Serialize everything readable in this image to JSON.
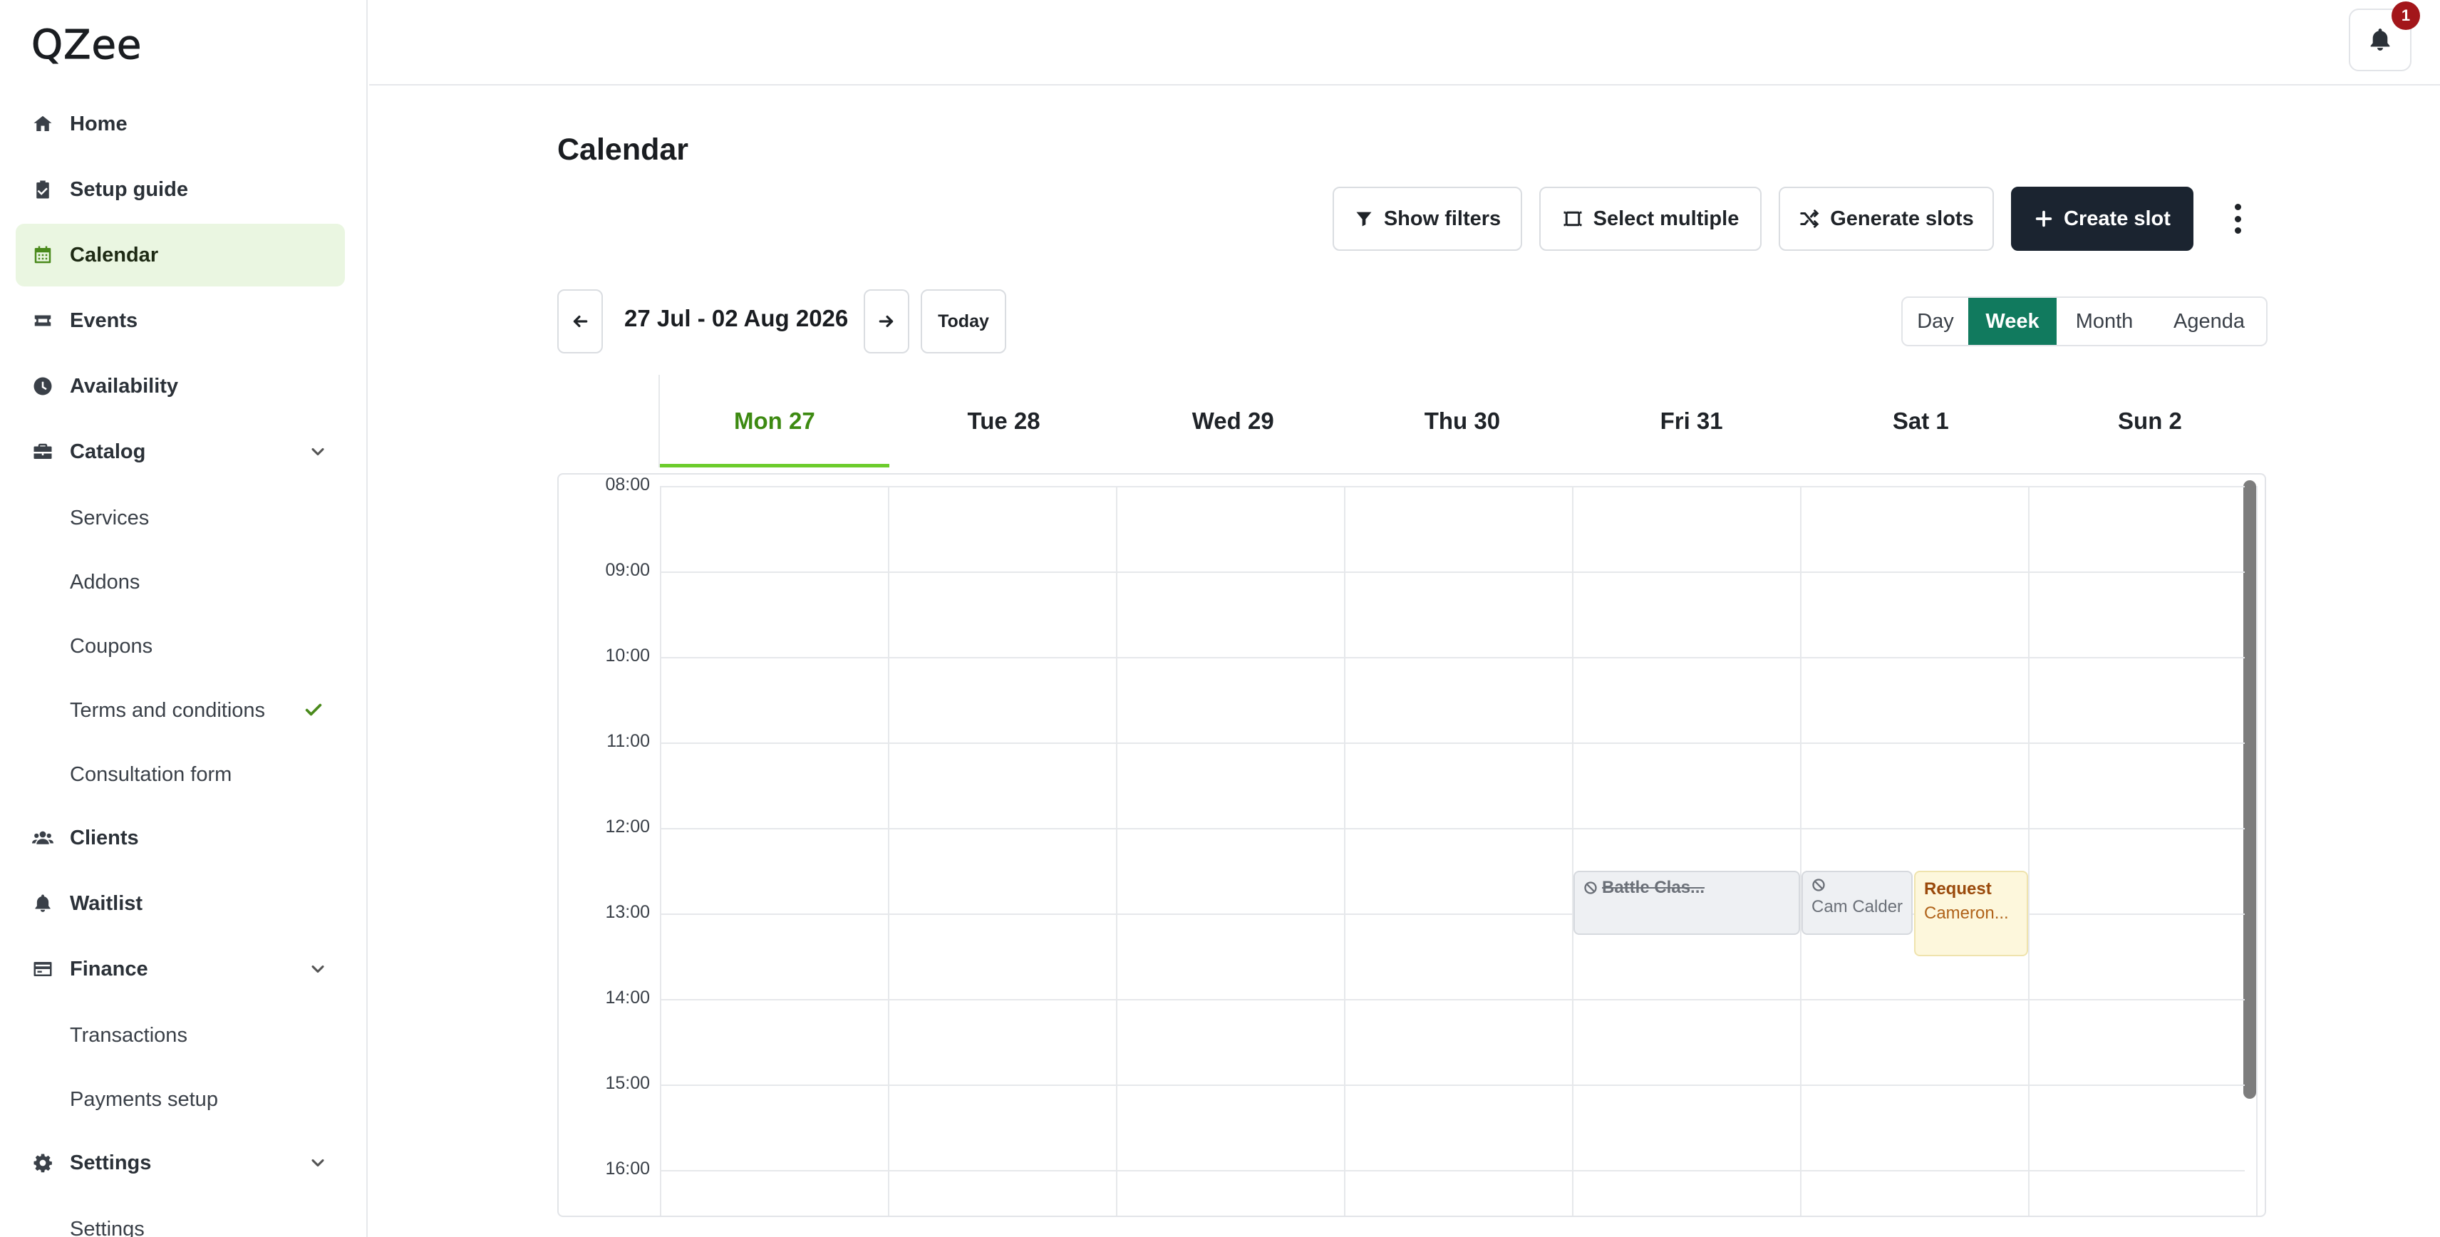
{
  "app": {
    "logo_text": "QZee"
  },
  "sidebar": {
    "items": [
      {
        "key": "home",
        "label": "Home",
        "icon": "home-icon"
      },
      {
        "key": "setup",
        "label": "Setup guide",
        "icon": "clipboard-check-icon"
      },
      {
        "key": "calendar",
        "label": "Calendar",
        "icon": "calendar-icon",
        "active": true
      },
      {
        "key": "events",
        "label": "Events",
        "icon": "ticket-icon"
      },
      {
        "key": "availability",
        "label": "Availability",
        "icon": "clock-icon"
      },
      {
        "key": "catalog",
        "label": "Catalog",
        "icon": "briefcase-icon",
        "expanded": true,
        "children": [
          {
            "label": "Services"
          },
          {
            "label": "Addons"
          },
          {
            "label": "Coupons"
          },
          {
            "label": "Terms and conditions",
            "checked": true
          },
          {
            "label": "Consultation form"
          }
        ]
      },
      {
        "key": "clients",
        "label": "Clients",
        "icon": "users-icon"
      },
      {
        "key": "waitlist",
        "label": "Waitlist",
        "icon": "bell-icon"
      },
      {
        "key": "finance",
        "label": "Finance",
        "icon": "credit-card-icon",
        "expanded": true,
        "children": [
          {
            "label": "Transactions"
          },
          {
            "label": "Payments setup"
          }
        ]
      },
      {
        "key": "settings",
        "label": "Settings",
        "icon": "gear-icon",
        "expanded": true,
        "children": [
          {
            "label": "Settings"
          }
        ]
      }
    ]
  },
  "topbar": {
    "notification_count": "1"
  },
  "page": {
    "title": "Calendar"
  },
  "toolbar": {
    "show_filters": "Show filters",
    "select_multiple": "Select multiple",
    "generate_slots": "Generate slots",
    "create_slot": "Create slot"
  },
  "calendar": {
    "range_label": "27 Jul - 02 Aug 2026",
    "today_label": "Today",
    "views": [
      "Day",
      "Week",
      "Month",
      "Agenda"
    ],
    "selected_view": "Week",
    "days": [
      "Mon 27",
      "Tue 28",
      "Wed 29",
      "Thu 30",
      "Fri 31",
      "Sat 1",
      "Sun 2"
    ],
    "today_day": "Mon 27",
    "hours": [
      "08:00",
      "09:00",
      "10:00",
      "11:00",
      "12:00",
      "13:00",
      "14:00",
      "15:00",
      "16:00"
    ],
    "events": [
      {
        "day": "Fri 31",
        "title": "Battle Clas...",
        "subtitle": "",
        "status": "blocked",
        "start": "12:30",
        "end": "13:15",
        "strikethrough": true
      },
      {
        "day": "Sat 1",
        "title": "",
        "subtitle": "Cam Calder",
        "status": "blocked",
        "start": "12:30",
        "end": "13:15"
      },
      {
        "day": "Sat 1",
        "title": "Request",
        "subtitle": "Cameron...",
        "status": "request",
        "start": "12:30",
        "end": "13:30"
      }
    ]
  },
  "colors": {
    "accent_green": "#117a5e",
    "today_green": "#6ccc2c",
    "primary_dark": "#1b2430",
    "badge_red": "#a3161a",
    "request_text": "#9a4a0c"
  }
}
